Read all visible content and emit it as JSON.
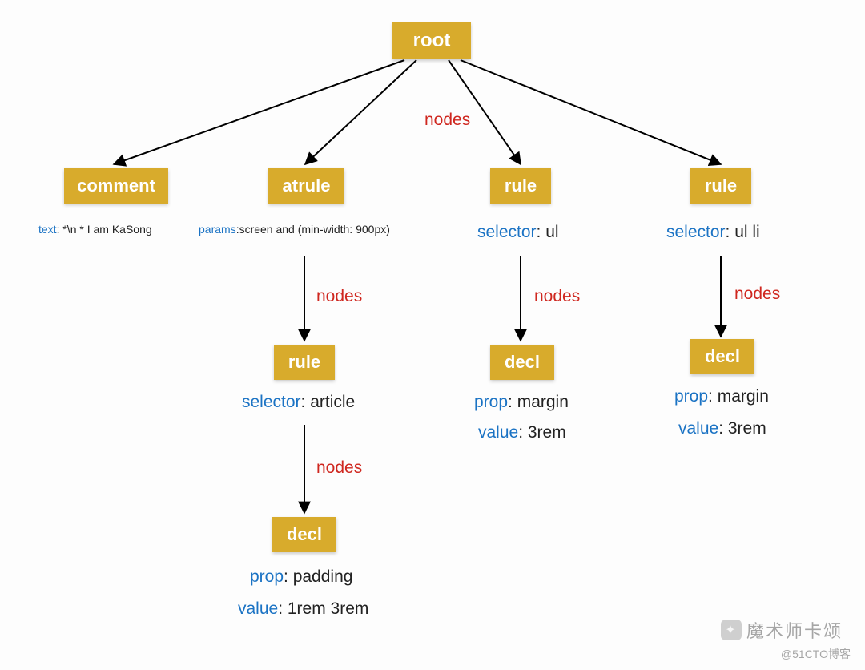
{
  "edge_label": "nodes",
  "root": {
    "label": "root"
  },
  "level1": {
    "comment": {
      "label": "comment",
      "ann": {
        "key": "text",
        "value": ": *\\n * I am KaSong"
      }
    },
    "atrule": {
      "label": "atrule",
      "ann": {
        "key": "params",
        "value": ":screen and (min-width: 900px)"
      }
    },
    "rule1": {
      "label": "rule",
      "ann": {
        "key": "selector",
        "value": ": ul"
      }
    },
    "rule2": {
      "label": "rule",
      "ann": {
        "key": "selector",
        "value": ": ul li"
      }
    }
  },
  "level2": {
    "atrule_rule": {
      "label": "rule",
      "ann": {
        "key": "selector",
        "value": ": article"
      }
    },
    "rule1_decl": {
      "label": "decl",
      "ann1": {
        "key": "prop",
        "value": ": margin"
      },
      "ann2": {
        "key": "value",
        "value": ": 3rem"
      }
    },
    "rule2_decl": {
      "label": "decl",
      "ann1": {
        "key": "prop",
        "value": ": margin"
      },
      "ann2": {
        "key": "value",
        "value": ": 3rem"
      }
    }
  },
  "level3": {
    "atrule_decl": {
      "label": "decl",
      "ann1": {
        "key": "prop",
        "value": ": padding"
      },
      "ann2": {
        "key": "value",
        "value": ": 1rem 3rem"
      }
    }
  },
  "watermark": {
    "main": "魔术师卡颂",
    "sub": "@51CTO博客"
  }
}
